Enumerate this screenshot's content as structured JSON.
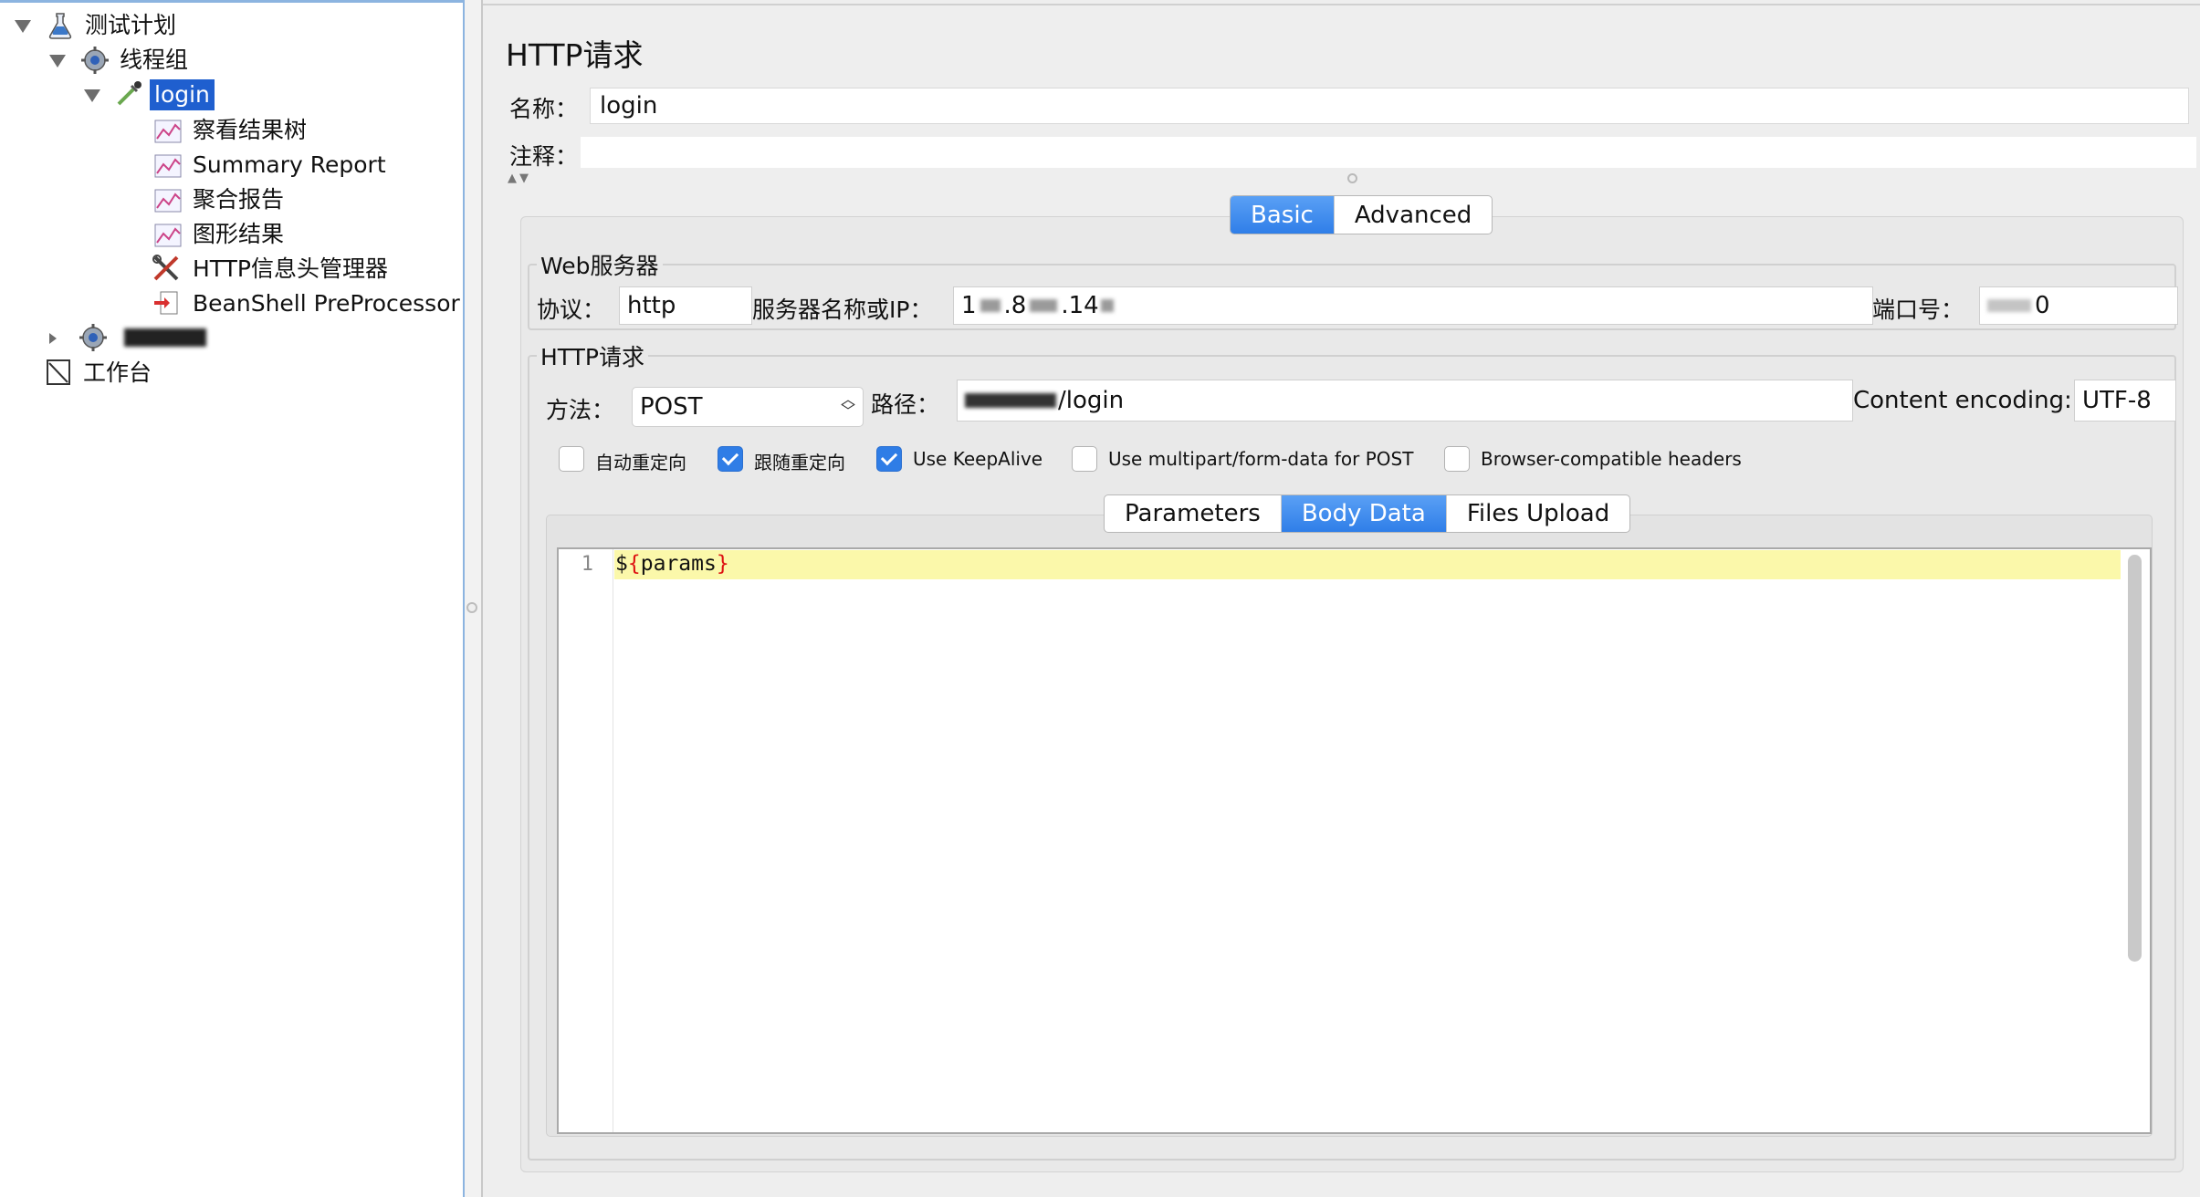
{
  "tree": {
    "items": [
      {
        "label": "测试计划",
        "icon": "flask-icon"
      },
      {
        "label": "线程组",
        "icon": "gear-icon"
      },
      {
        "label": "login",
        "icon": "pipette-icon",
        "selected": true
      },
      {
        "label": "察看结果树",
        "icon": "graph-icon"
      },
      {
        "label": "Summary Report",
        "icon": "graph-icon"
      },
      {
        "label": "聚合报告",
        "icon": "graph-icon"
      },
      {
        "label": "图形结果",
        "icon": "graph-icon"
      },
      {
        "label": "HTTP信息头管理器",
        "icon": "tools-icon"
      },
      {
        "label": "BeanShell PreProcessor",
        "icon": "preprocessor-icon"
      },
      {
        "label": "",
        "icon": "gear-icon",
        "redacted": true
      },
      {
        "label": "工作台",
        "icon": "workbench-icon"
      }
    ]
  },
  "sampler": {
    "title": "HTTP请求",
    "name_label": "名称：",
    "name_value": "login",
    "comment_label": "注释："
  },
  "tabs": {
    "main": [
      "Basic",
      "Advanced"
    ],
    "main_active": "Basic",
    "body": [
      "Parameters",
      "Body Data",
      "Files Upload"
    ],
    "body_active": "Body Data"
  },
  "web_server": {
    "legend": "Web服务器",
    "protocol_label": "协议：",
    "protocol_value": "http",
    "server_label": "服务器名称或IP：",
    "server_value_visible_start": "1",
    "server_value_visible_middle": ".8",
    "server_value_visible_end": ".14",
    "port_label": "端口号：",
    "port_value_visible": "0"
  },
  "http_request": {
    "legend": "HTTP请求",
    "method_label": "方法：",
    "method_value": "POST",
    "path_label": "路径：",
    "path_value_visible": "/login",
    "encoding_label": "Content encoding:",
    "encoding_value": "UTF-8"
  },
  "options": [
    {
      "label": "自动重定向",
      "checked": false
    },
    {
      "label": "跟随重定向",
      "checked": true
    },
    {
      "label": "Use KeepAlive",
      "checked": true
    },
    {
      "label": "Use multipart/form-data for POST",
      "checked": false
    },
    {
      "label": "Browser-compatible headers",
      "checked": false
    }
  ],
  "body_editor": {
    "line_number": "1",
    "code": "${params}"
  },
  "colors": {
    "selection": "#1f5fcf",
    "tab_active": "#2f7ee8",
    "editor_highlight": "#fbf8aa"
  }
}
